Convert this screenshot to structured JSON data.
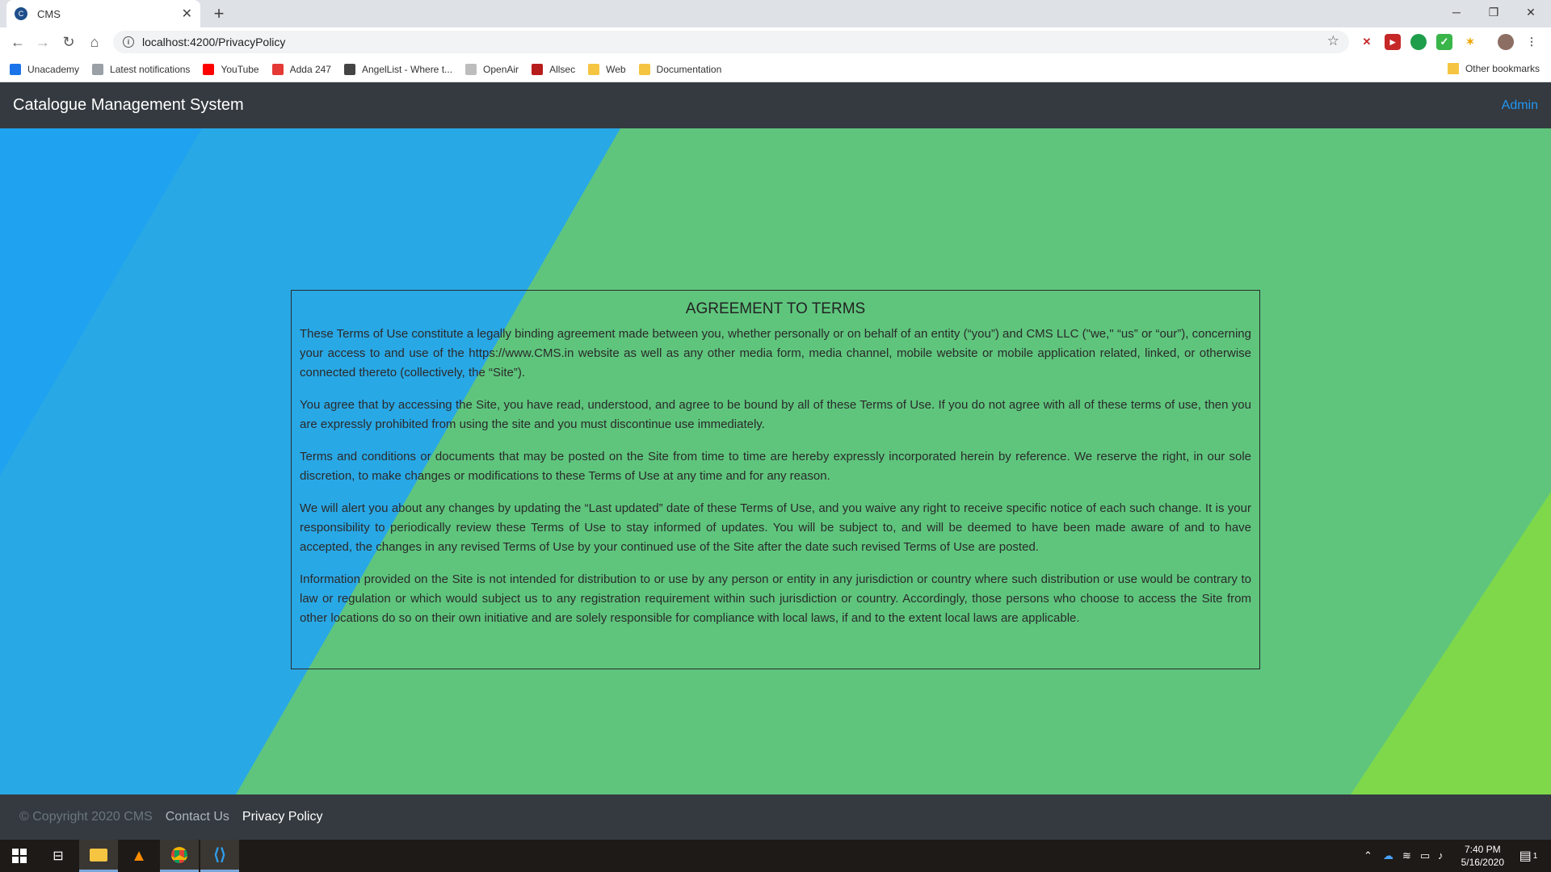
{
  "browser": {
    "tab_title": "CMS",
    "tab_favicon_text": "C",
    "url": "localhost:4200/PrivacyPolicy",
    "bookmarks": [
      "Unacademy",
      "Latest notifications",
      "YouTube",
      "Adda 247",
      "AngelList - Where t...",
      "OpenAir",
      "Allsec",
      "Web",
      "Documentation"
    ],
    "other_bookmarks": "Other bookmarks"
  },
  "header": {
    "brand": "Catalogue Management System",
    "admin_link": "Admin"
  },
  "terms": {
    "title": "AGREEMENT TO TERMS",
    "paragraphs": [
      "These Terms of Use constitute a legally binding agreement made between you, whether personally or on behalf of an entity (“you”) and CMS LLC (\"we,\" “us” or “our”), concerning your access to and use of the https://www.CMS.in website as well as any other media form, media channel, mobile website or mobile application related, linked, or otherwise connected thereto (collectively, the “Site”).",
      "You agree that by accessing the Site, you have read, understood, and agree to be bound by all of these Terms of Use. If you do not agree with all of these terms of use, then you are expressly prohibited from using the site and you must discontinue use immediately.",
      "Terms and conditions or documents that may be posted on the Site from time to time are hereby expressly incorporated herein by reference. We reserve the right, in our sole discretion, to make changes or modifications to these Terms of Use at any time and for any reason.",
      "We will alert you about any changes by updating the “Last updated” date of these Terms of Use, and you waive any right to receive specific notice of each such change. It is your responsibility to periodically review these Terms of Use to stay informed of updates. You will be subject to, and will be deemed to have been made aware of and to have accepted, the changes in any revised Terms of Use by your continued use of the Site after the date such revised Terms of Use are posted.",
      "Information provided on the Site is not intended for distribution to or use by any person or entity in any jurisdiction or country where such distribution or use would be contrary to law or regulation or which would subject us to any registration requirement within such jurisdiction or country. Accordingly, those persons who choose to access the Site from other locations do so on their own initiative and are solely responsible for compliance with local laws, if and to the extent local laws are applicable."
    ]
  },
  "footer": {
    "copyright": "© Copyright 2020 CMS",
    "contact": "Contact Us",
    "privacy": "Privacy Policy"
  },
  "taskbar": {
    "time": "7:40 PM",
    "date": "5/16/2020",
    "notification_count": "1"
  },
  "colors": {
    "page_green": "#5fc57d",
    "blue_stripe": "#1fa3f0",
    "light_blue_stripe": "#29a8e6",
    "lime_corner": "#7ed84a",
    "navbar": "#343a40",
    "admin_link": "#2196f3"
  }
}
